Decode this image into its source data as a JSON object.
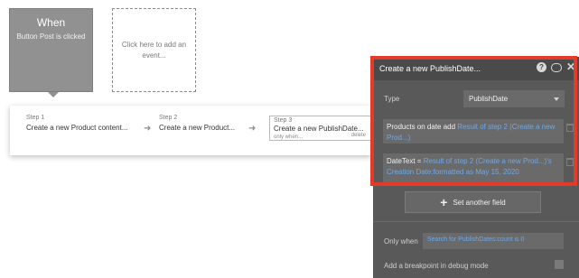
{
  "event": {
    "title": "When",
    "subtitle": "Button Post is clicked"
  },
  "add_event": {
    "label": "Click here to add an event..."
  },
  "steps": [
    {
      "label": "Step 1",
      "text": "Create a new Product content..."
    },
    {
      "label": "Step 2",
      "text": "Create a new Product..."
    },
    {
      "label": "Step 3",
      "text": "Create a new PublishDate...",
      "only_when": "only when...",
      "delete": "delete"
    }
  ],
  "panel": {
    "title": "Create a new PublishDate...",
    "type_label": "Type",
    "type_value": "PublishDate",
    "fields": [
      {
        "name": "Products on date add",
        "value": "Result of step 2 (Create a new Prod...)"
      },
      {
        "name": "DateText =",
        "value": "Result of step 2 (Create a new Prod...)'s Creation Date:formatted as May 15, 2020"
      }
    ],
    "set_field_label": "Set another field",
    "only_when_label": "Only when",
    "only_when_value": "Search for PublishDates:count is 0",
    "breakpoint_label": "Add a breakpoint in debug mode"
  },
  "colors": {
    "highlight": "#e53a2a",
    "dynamic_text": "#6fa8e6",
    "panel_bg": "#595959"
  }
}
